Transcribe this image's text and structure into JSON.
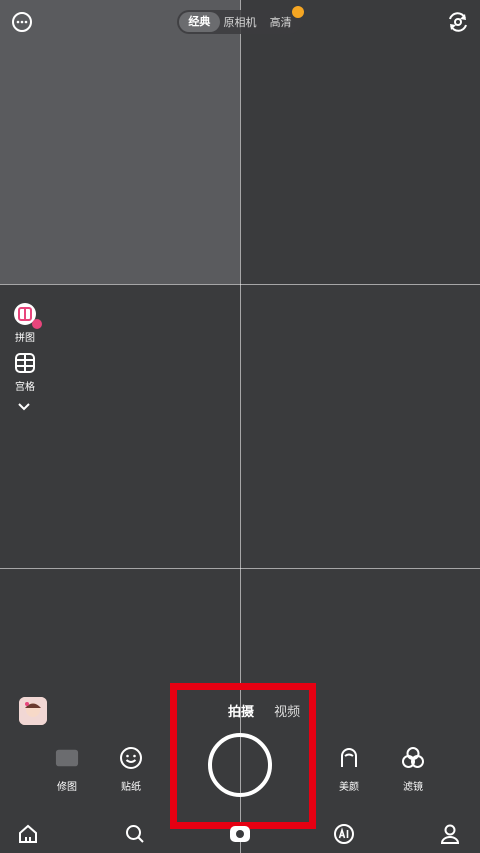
{
  "top": {
    "mode_options": [
      "经典",
      "原相机",
      "高清"
    ],
    "active_mode_index": 0,
    "left_icon": "more-icon",
    "right_icon": "camera-flip-icon"
  },
  "side_tools": {
    "collage_label": "拼图",
    "grid_label": "宫格"
  },
  "capture": {
    "photo_label": "拍摄",
    "video_label": "视频"
  },
  "bottom_tools": {
    "retouch_label": "修图",
    "sticker_label": "贴纸",
    "beauty_label": "美颜",
    "filter_label": "滤镜"
  },
  "nav": {
    "items": [
      "home-icon",
      "search-icon",
      "camera-icon",
      "ai-icon",
      "profile-icon"
    ]
  },
  "colors": {
    "accent_red": "#e60012",
    "badge_pink": "#e8457c",
    "crown_orange": "#f5a623"
  }
}
